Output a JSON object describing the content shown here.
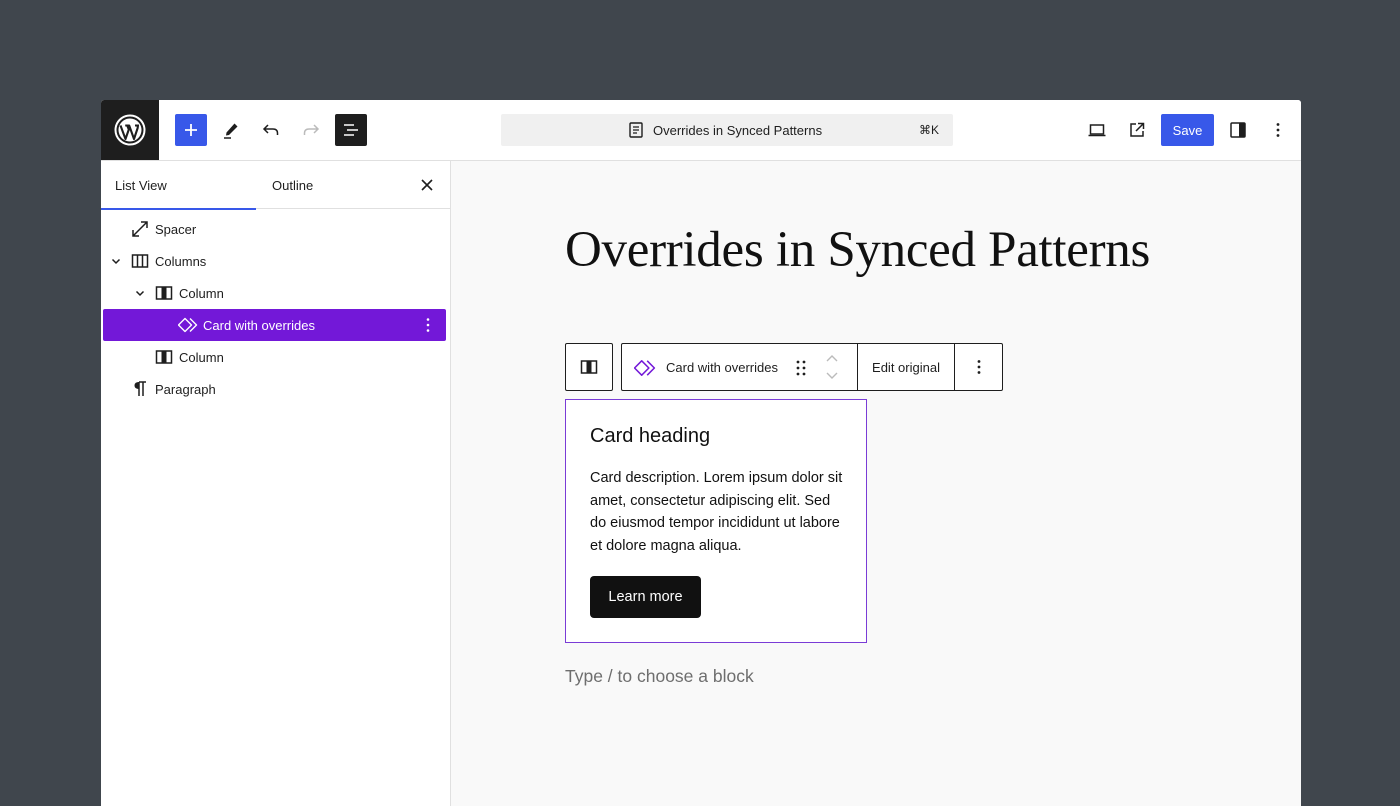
{
  "topbar": {
    "logo_icon": "wordpress-logo",
    "inserter_icon": "plus-icon",
    "tools_icon": "pencil-icon",
    "undo_icon": "undo-icon",
    "redo_icon": "redo-icon",
    "list_view_icon": "list-view-icon",
    "document_title": "Overrides in Synced Patterns",
    "shortcut": "⌘K",
    "save_label": "Save",
    "accent_color": "#3858e9"
  },
  "sidebar": {
    "tabs": [
      {
        "label": "List View",
        "active": true
      },
      {
        "label": "Outline",
        "active": false
      }
    ],
    "items": [
      {
        "label": "Spacer",
        "icon": "spacer-icon",
        "level": 1,
        "expanded": null,
        "selected": false
      },
      {
        "label": "Columns",
        "icon": "columns-icon",
        "level": 1,
        "expanded": true,
        "selected": false
      },
      {
        "label": "Column",
        "icon": "column-icon",
        "level": 2,
        "expanded": true,
        "selected": false
      },
      {
        "label": "Card with overrides",
        "icon": "synced-pattern-icon",
        "level": 3,
        "expanded": null,
        "selected": true
      },
      {
        "label": "Column",
        "icon": "column-icon",
        "level": 2,
        "expanded": null,
        "selected": false
      },
      {
        "label": "Paragraph",
        "icon": "paragraph-icon",
        "level": 1,
        "expanded": null,
        "selected": false
      }
    ],
    "selected_color": "#7318d8"
  },
  "canvas": {
    "page_title": "Overrides in Synced Patterns",
    "block_toolbar": {
      "block_name": "Card with overrides",
      "edit_original": "Edit original"
    },
    "card": {
      "heading": "Card heading",
      "description": "Card description. Lorem ipsum dolor sit amet, consectetur adipiscing elit. Sed do eiusmod tempor incididunt ut labore et dolore magna aliqua.",
      "button_label": "Learn more",
      "border_color": "#7a3cd6"
    },
    "appender_placeholder": "Type / to choose a block"
  }
}
